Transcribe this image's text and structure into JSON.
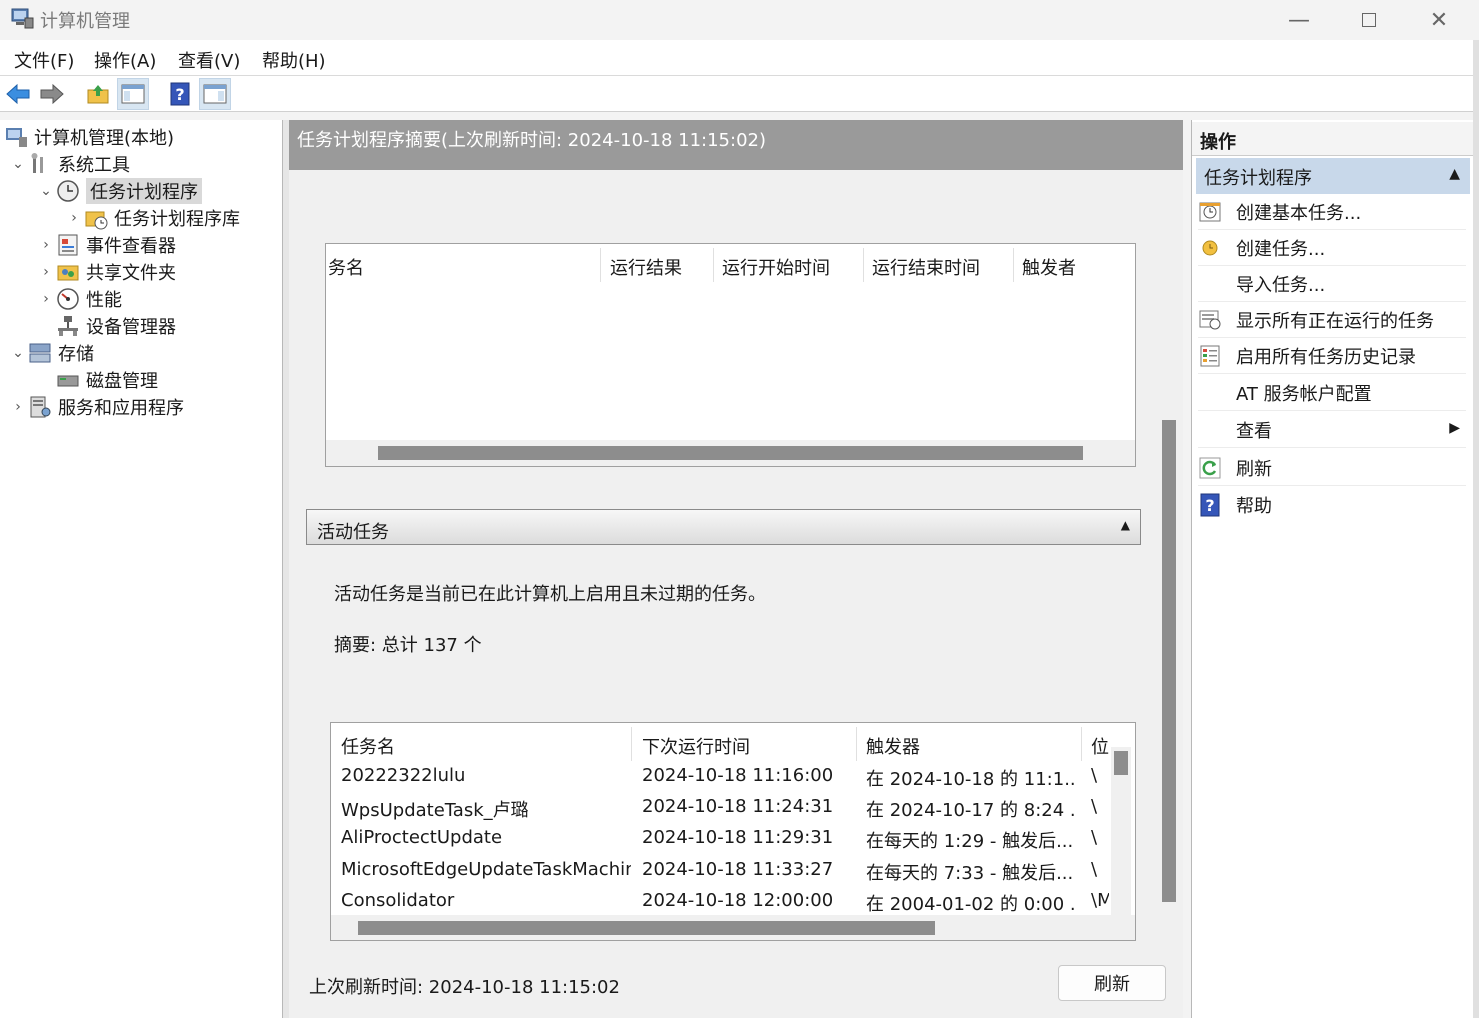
{
  "window": {
    "title": "计算机管理"
  },
  "menu": [
    "文件(F)",
    "操作(A)",
    "查看(V)",
    "帮助(H)"
  ],
  "tree": {
    "root": "计算机管理(本地)",
    "system_tools": "系统工具",
    "task_scheduler": "任务计划程序",
    "task_scheduler_library": "任务计划程序库",
    "event_viewer": "事件查看器",
    "shared_folders": "共享文件夹",
    "performance": "性能",
    "device_manager": "设备管理器",
    "storage": "存储",
    "disk_management": "磁盘管理",
    "services_apps": "服务和应用程序"
  },
  "center": {
    "header": "任务计划程序摘要(上次刷新时间: 2024-10-18 11:15:02)",
    "status_table": {
      "columns": [
        "务名",
        "运行结果",
        "运行开始时间",
        "运行结束时间",
        "触发者"
      ]
    },
    "active_section": {
      "title": "活动任务",
      "description": "活动任务是当前已在此计算机上启用且未过期的任务。",
      "summary": "摘要: 总计 137 个",
      "columns": [
        "任务名",
        "下次运行时间",
        "触发器",
        "位"
      ],
      "rows": [
        {
          "name": "20222322lulu",
          "next": "2024-10-18 11:16:00",
          "trigger": "在 2024-10-18 的 11:1...",
          "loc": "\\"
        },
        {
          "name": "WpsUpdateTask_卢璐",
          "next": "2024-10-18 11:24:31",
          "trigger": "在 2024-10-17 的 8:24 ...",
          "loc": "\\"
        },
        {
          "name": "AliProctectUpdate",
          "next": "2024-10-18 11:29:31",
          "trigger": "在每天的 1:29 - 触发后...",
          "loc": "\\"
        },
        {
          "name": "MicrosoftEdgeUpdateTaskMachin...",
          "next": "2024-10-18 11:33:27",
          "trigger": "在每天的 7:33 - 触发后...",
          "loc": "\\"
        },
        {
          "name": "Consolidator",
          "next": "2024-10-18 12:00:00",
          "trigger": "在 2004-01-02 的 0:00 ...",
          "loc": "\\M"
        }
      ]
    },
    "last_refresh": "上次刷新时间: 2024-10-18 11:15:02",
    "refresh_button": "刷新"
  },
  "actions": {
    "title": "操作",
    "group": "任务计划程序",
    "items": [
      {
        "label": "创建基本任务...",
        "icon": "clock-task-icon"
      },
      {
        "label": "创建任务...",
        "icon": "new-task-icon"
      },
      {
        "label": "导入任务...",
        "icon": ""
      },
      {
        "label": "显示所有正在运行的任务",
        "icon": "running-tasks-icon"
      },
      {
        "label": "启用所有任务历史记录",
        "icon": "history-icon"
      },
      {
        "label": "AT 服务帐户配置",
        "icon": ""
      },
      {
        "label": "查看",
        "icon": ""
      },
      {
        "label": "刷新",
        "icon": "refresh-icon"
      },
      {
        "label": "帮助",
        "icon": "help-icon"
      }
    ]
  }
}
